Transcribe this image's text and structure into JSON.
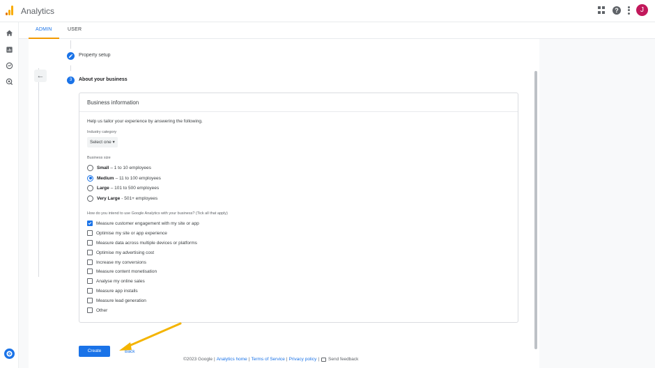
{
  "app": {
    "title": "Analytics",
    "avatar_initial": "J",
    "avatar_color": "#c2185b",
    "accent": "#1a73e8",
    "logo_colors": [
      "#f9ab00",
      "#e37400"
    ],
    "top_icons": [
      "apps-grid-icon",
      "help-icon",
      "more-vert-icon"
    ]
  },
  "leftnav": {
    "icons": [
      "home-icon",
      "reports-icon",
      "explore-icon",
      "advertising-icon",
      "admin-settings-icon"
    ]
  },
  "tabs": [
    {
      "label": "ADMIN",
      "active": true
    },
    {
      "label": "USER",
      "active": false
    }
  ],
  "steps": [
    {
      "label": "Property setup",
      "state": "completed"
    },
    {
      "number": "3",
      "label": "About your business",
      "state": "current"
    }
  ],
  "card": {
    "title": "Business information",
    "help_text": "Help us tailor your experience by answering the following.",
    "industry": {
      "label": "Industry category",
      "value": "Select one"
    },
    "business_size": {
      "label": "Business size",
      "options": [
        {
          "name": "Small",
          "detail": "– 1 to 10 employees",
          "selected": false
        },
        {
          "name": "Medium",
          "detail": "– 11 to 100 employees",
          "selected": true
        },
        {
          "name": "Large",
          "detail": "– 101 to 500 employees",
          "selected": false
        },
        {
          "name": "Very Large",
          "detail": "- 501+ employees",
          "selected": false
        }
      ]
    },
    "intent": {
      "label": "How do you intend to use Google Analytics with your business? (Tick all that apply)",
      "options": [
        {
          "label": "Measure customer engagement with my site or app",
          "checked": true
        },
        {
          "label": "Optimise my site or app experience",
          "checked": false
        },
        {
          "label": "Measure data across multiple devices or platforms",
          "checked": false
        },
        {
          "label": "Optimise my advertising cost",
          "checked": false
        },
        {
          "label": "Increase my conversions",
          "checked": false
        },
        {
          "label": "Measure content monetisation",
          "checked": false
        },
        {
          "label": "Analyse my online sales",
          "checked": false
        },
        {
          "label": "Measure app installs",
          "checked": false
        },
        {
          "label": "Measure lead generation",
          "checked": false
        },
        {
          "label": "Other",
          "checked": false
        }
      ]
    }
  },
  "actions": {
    "create_label": "Create",
    "back_label": "Back"
  },
  "footer": {
    "copyright": "©2023 Google",
    "links": [
      "Analytics home",
      "Terms of Service",
      "Privacy policy"
    ],
    "feedback": "Send feedback"
  },
  "annotation": {
    "arrow_color": "#f4b400"
  }
}
